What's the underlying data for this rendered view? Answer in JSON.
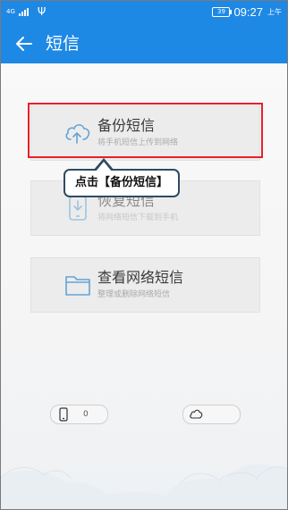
{
  "status_bar": {
    "network": "4G",
    "battery": "39",
    "time": "09:27",
    "ampm": "上午"
  },
  "app_bar": {
    "title": "短信"
  },
  "cards": {
    "backup": {
      "title": "备份短信",
      "subtitle": "将手机短信上传到网络"
    },
    "restore": {
      "title": "恢复短信",
      "subtitle": "将网络短信下载到手机"
    },
    "cloud": {
      "title": "查看网络短信",
      "subtitle": "整理或删除网络短信"
    }
  },
  "callout": {
    "text": "点击【备份短信】"
  },
  "bottom": {
    "phone_count": "0",
    "cloud_count": ""
  },
  "colors": {
    "brand_blue": "#1e88e5",
    "highlight_red": "#e8202a",
    "callout_border": "#2f4b62"
  }
}
